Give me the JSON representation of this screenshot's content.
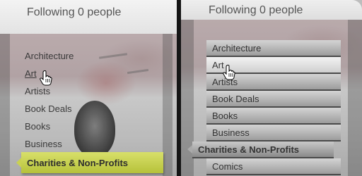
{
  "left": {
    "header_text": "Following 0 people",
    "items": [
      {
        "label": "Architecture"
      },
      {
        "label": "Art"
      },
      {
        "label": "Artists"
      },
      {
        "label": "Book Deals"
      },
      {
        "label": "Books"
      },
      {
        "label": "Business"
      }
    ],
    "active_item": "Charities & Non-Profits"
  },
  "right": {
    "header_text": "Following 0 people",
    "items": [
      {
        "label": "Architecture"
      },
      {
        "label": "Art"
      },
      {
        "label": "Artists"
      },
      {
        "label": "Book Deals"
      },
      {
        "label": "Books"
      },
      {
        "label": "Business"
      },
      {
        "label": "Charities & Non-Profits"
      },
      {
        "label": "Comics"
      }
    ]
  },
  "colors": {
    "active_pill": "#c9d152",
    "text": "#3a3a3a"
  },
  "icons": [
    "hand-pointer-cursor-icon"
  ]
}
